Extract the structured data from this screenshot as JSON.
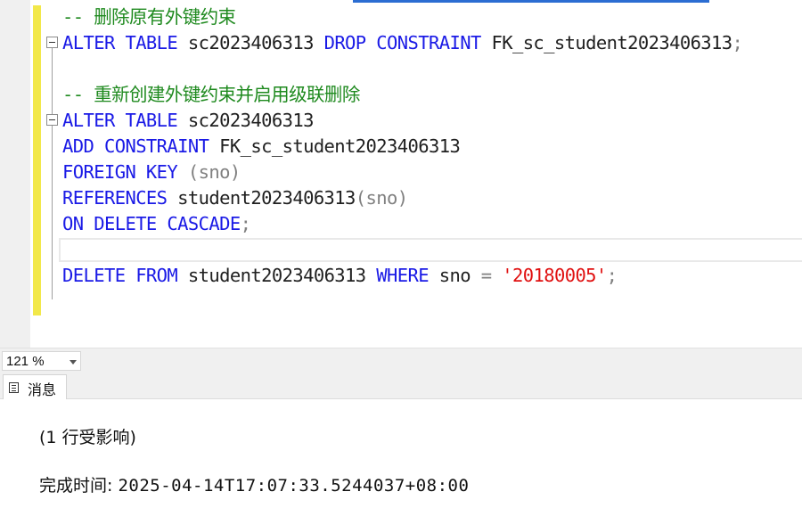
{
  "editor": {
    "comment1": "-- 删除原有外键约束",
    "line_drop": {
      "kw1": "ALTER TABLE",
      "table": "sc2023406313",
      "kw2": "DROP CONSTRAINT",
      "name": "FK_sc_student2023406313",
      "end": ";"
    },
    "comment2": "-- 重新创建外键约束并启用级联删除",
    "line_alter": {
      "kw": "ALTER TABLE",
      "table": "sc2023406313"
    },
    "line_add": {
      "kw": "ADD CONSTRAINT",
      "name": "FK_sc_student2023406313"
    },
    "line_fk": {
      "kw": "FOREIGN KEY",
      "col": "(sno)"
    },
    "line_ref": {
      "kw": "REFERENCES",
      "table": "student2023406313",
      "col": "(sno)"
    },
    "line_on": {
      "kw": "ON DELETE CASCADE",
      "end": ";"
    },
    "line_delete": {
      "kw1": "DELETE FROM",
      "table": "student2023406313",
      "kw2": "WHERE",
      "col": "sno",
      "op": "=",
      "str": "'20180005'",
      "end": ";"
    }
  },
  "zoom": {
    "value": "121 %"
  },
  "results": {
    "tab_label": "消息",
    "rows_affected": "(1 行受影响)",
    "time_label": "完成时间: ",
    "time_value": "2025-04-14T17:07:33.5244037+08:00"
  },
  "colors": {
    "keyword": "#1a1ae6",
    "comment": "#1f8a1f",
    "string": "#e01010",
    "change_bar": "#f2e84a"
  }
}
